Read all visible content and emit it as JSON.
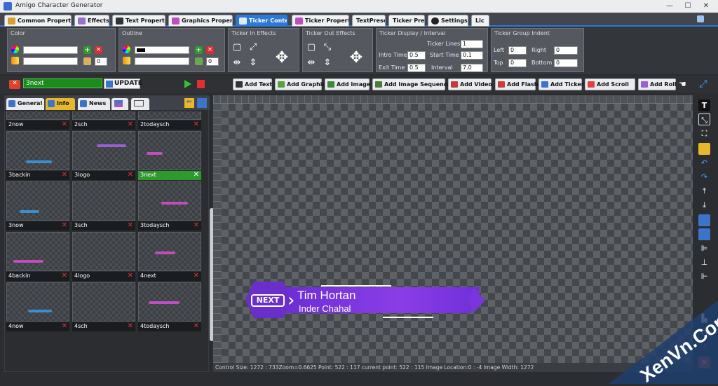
{
  "app": {
    "title": "Amigo Character Generator"
  },
  "tabs": [
    {
      "label": "Common Properties"
    },
    {
      "label": "Effects"
    },
    {
      "label": "Text Properties"
    },
    {
      "label": "Graphics Properties"
    },
    {
      "label": "Ticker Content"
    },
    {
      "label": "Ticker Properties"
    },
    {
      "label": "TextPreset"
    },
    {
      "label": "Ticker Preset"
    },
    {
      "label": "Settings"
    },
    {
      "label": "Lic"
    }
  ],
  "ribbon": {
    "color_title": "Color",
    "outline_title": "Outline",
    "color_spin": "0",
    "outline_spin": "0",
    "in_effects_title": "Ticker In Effects",
    "out_effects_title": "Ticker Out Effects",
    "display_title": "Ticker Display / Interval",
    "ticker_lines_label": "Ticker Lines",
    "ticker_lines": "1",
    "intro_time_label": "Intro Time",
    "intro_time": "0.5",
    "start_time_label": "Start Time",
    "start_time": "0.1",
    "exit_time_label": "Exit Time",
    "exit_time": "0.5",
    "interval_label": "Interval",
    "interval": "7.0",
    "indent_title": "Ticker Group Indent",
    "left_label": "Left",
    "left": "0",
    "right_label": "Right",
    "right": "0",
    "top_label": "Top",
    "top": "0",
    "bottom_label": "Bottom",
    "bottom": "0"
  },
  "toolbar": {
    "name_value": "3next",
    "update_label": "UPDATE",
    "buttons": [
      "Add Text",
      "Add Graphic",
      "Add Image",
      "Add Image Sequence",
      "Add Video",
      "Add Flash",
      "Add Ticker",
      "Add Scroll",
      "Add Roll"
    ]
  },
  "left": {
    "tabs": [
      "General",
      "Info",
      "News"
    ],
    "items": [
      {
        "name": "2now"
      },
      {
        "name": "2sch"
      },
      {
        "name": "2todaysch"
      },
      {
        "name": "3backin"
      },
      {
        "name": "3logo"
      },
      {
        "name": "3next"
      },
      {
        "name": "3now"
      },
      {
        "name": "3sch"
      },
      {
        "name": "3todaysch"
      },
      {
        "name": "4backin"
      },
      {
        "name": "4logo"
      },
      {
        "name": "4next"
      },
      {
        "name": "4now"
      },
      {
        "name": "4sch"
      },
      {
        "name": "4todaysch"
      }
    ]
  },
  "lowerthird": {
    "badge": "NEXT",
    "line1": "Tim Hortan",
    "line2": "Inder Chahal"
  },
  "status": {
    "text": "Control Size: 1272 : 733Zoom=0.6625  Point: 522 : 117 current point: 522 : 115 Image Location:0 : -4 Image Width: 1272"
  },
  "watermark": {
    "text": "XenVn.Com"
  },
  "colors": {
    "accent": "#2b78d6",
    "selected": "#2e9a2e",
    "lowerthird": "#7a35dd"
  }
}
